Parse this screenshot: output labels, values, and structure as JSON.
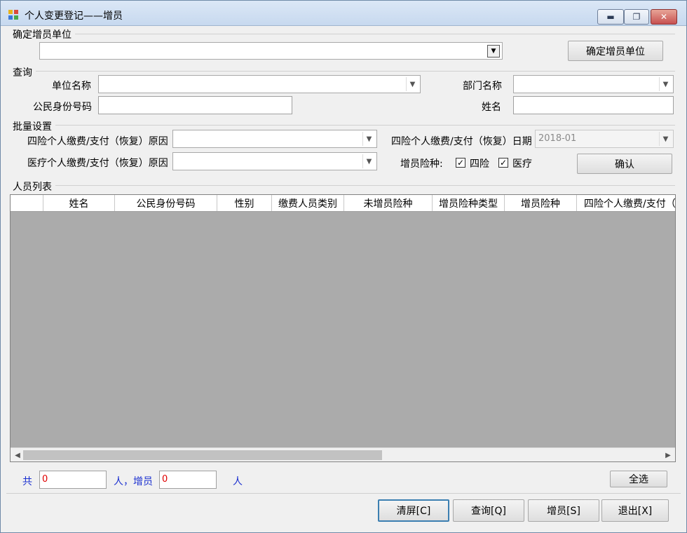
{
  "window": {
    "title": "个人变更登记——增员",
    "minimize_glyph": "▬",
    "restore_glyph": "❐",
    "close_glyph": "✕"
  },
  "unit_section": {
    "label": "确定增员单位",
    "combo_value": "",
    "confirm_button": "确定增员单位"
  },
  "query_section": {
    "label": "查询",
    "unit_name_label": "单位名称",
    "dept_name_label": "部门名称",
    "id_label": "公民身份号码",
    "name_label": "姓名"
  },
  "batch_section": {
    "label": "批量设置",
    "four_reason_label": "四险个人缴费/支付（恢复）原因",
    "medical_reason_label": "医疗个人缴费/支付（恢复）原因",
    "four_date_label": "四险个人缴费/支付（恢复）日期",
    "four_date_value": "2018-01",
    "insurance_label": "增员险种:",
    "four_checkbox_label": "四险",
    "four_checked": true,
    "medical_checkbox_label": "医疗",
    "medical_checked": true,
    "confirm_button": "确认"
  },
  "list_section": {
    "label": "人员列表",
    "columns": [
      "",
      "姓名",
      "公民身份号码",
      "性别",
      "缴费人员类别",
      "未增员险种",
      "增员险种类型",
      "增员险种",
      "四险个人缴费/支付（"
    ]
  },
  "footer": {
    "total_prefix": "共",
    "total_value": "0",
    "added_label": "人，增员",
    "added_value": "0",
    "person_suffix": "人",
    "select_all_button": "全选",
    "clear_button": "清屏[C]",
    "query_button": "查询[Q]",
    "add_button": "增员[S]",
    "exit_button": "退出[X]"
  },
  "icons": {
    "dropdown": "▼",
    "check": "✓",
    "scroll_left": "◀",
    "scroll_right": "▶"
  }
}
